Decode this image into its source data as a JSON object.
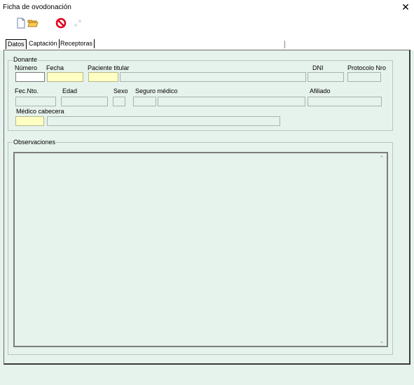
{
  "window": {
    "title": "Ficha de ovodonación",
    "close_symbol": "✕"
  },
  "toolbar": {
    "icons": [
      "new-document-icon",
      "open-folder-icon",
      "cancel-icon",
      "disabled-expand-icon"
    ]
  },
  "tabs": [
    {
      "label": "Datos",
      "active": true
    },
    {
      "label": "Captación",
      "active": false
    },
    {
      "label": "Receptoras",
      "active": false
    }
  ],
  "donante": {
    "group_title": "Donante",
    "labels": {
      "numero": "Número",
      "fecha": "Fecha",
      "paciente_titular": "Paciente titular",
      "dni": "DNI",
      "protocolo_nro": "Protocolo Nro",
      "fec_nto": "Fec.Nto.",
      "edad": "Edad",
      "sexo": "Sexo",
      "seguro_medico": "Seguro médico",
      "afiliado": "Afiliado",
      "medico_cabecera": "Médico cabecera"
    },
    "values": {
      "numero": "",
      "fecha": "",
      "paciente_titular_code": "",
      "paciente_titular_name": "",
      "dni": "",
      "protocolo_nro": "",
      "fec_nto": "",
      "edad": "",
      "sexo": "",
      "seguro_medico_code": "",
      "seguro_medico_name": "",
      "afiliado": "",
      "medico_cabecera_code": "",
      "medico_cabecera_name": ""
    }
  },
  "observaciones": {
    "group_title": "Observaciones",
    "text": ""
  },
  "colors": {
    "panel_bg": "#e6f2ec",
    "required_field": "#ffffc4",
    "cancel_red": "#e0001a"
  }
}
